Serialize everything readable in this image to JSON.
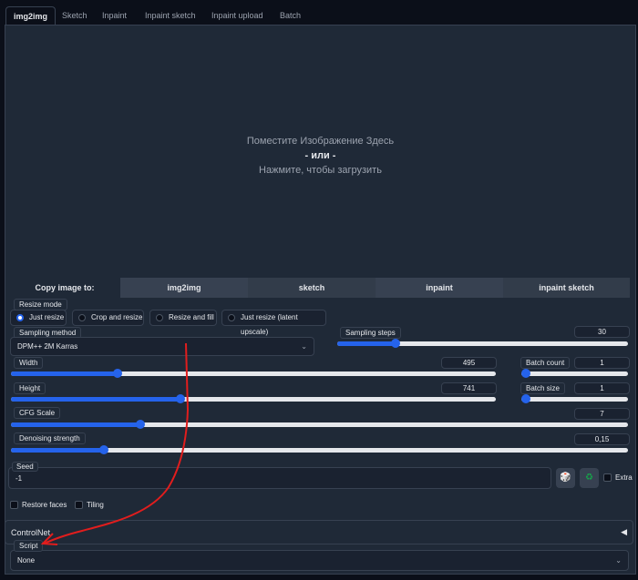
{
  "tabs": [
    "img2img",
    "Sketch",
    "Inpaint",
    "Inpaint sketch",
    "Inpaint upload",
    "Batch"
  ],
  "drop": {
    "line1": "Поместите Изображение Здесь",
    "line2": "- или -",
    "line3": "Нажмите, чтобы загрузить"
  },
  "copy": {
    "label": "Copy image to:",
    "buttons": [
      "img2img",
      "sketch",
      "inpaint",
      "inpaint sketch"
    ]
  },
  "resize": {
    "label": "Resize mode",
    "options": [
      "Just resize",
      "Crop and resize",
      "Resize and fill",
      "Just resize (latent upscale)"
    ],
    "selected": "Just resize"
  },
  "sampling_method": {
    "label": "Sampling method",
    "value": "DPM++ 2M Karras"
  },
  "sampling_steps": {
    "label": "Sampling steps",
    "value": "30",
    "fraction": 0.2
  },
  "width": {
    "label": "Width",
    "value": "495",
    "fraction": 0.22
  },
  "height": {
    "label": "Height",
    "value": "741",
    "fraction": 0.35
  },
  "batch_count": {
    "label": "Batch count",
    "value": "1",
    "fraction": 0
  },
  "batch_size": {
    "label": "Batch size",
    "value": "1",
    "fraction": 0
  },
  "cfg": {
    "label": "CFG Scale",
    "value": "7",
    "fraction": 0.21
  },
  "denoise": {
    "label": "Denoising strength",
    "value": "0,15",
    "fraction": 0.15
  },
  "seed": {
    "label": "Seed",
    "value": "-1",
    "extra": "Extra"
  },
  "checks": {
    "restore": "Restore faces",
    "tiling": "Tiling"
  },
  "controlnet": {
    "label": "ControlNet"
  },
  "script": {
    "label": "Script",
    "value": "None"
  },
  "colors": {
    "accent": "#2563eb",
    "annotation": "#e11d1d"
  }
}
